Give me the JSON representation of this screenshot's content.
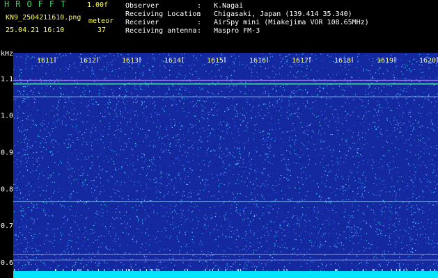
{
  "header": {
    "app_title": "HROFFT",
    "version": "1.00f",
    "file_name": "KN9_2504211610.png",
    "mode": "meteor",
    "datetime": "25.04.21 16:10",
    "count": "37",
    "info": [
      {
        "label": "Observer",
        "value": "K.Nagai"
      },
      {
        "label": "Receiving Location",
        "value": "Chigasaki, Japan (139.414 35.340)"
      },
      {
        "label": "Receiver",
        "value": "AirSpy mini (Miakejima VOR 108.65MHz)"
      },
      {
        "label": "Receiving antenna",
        "value": "Maspro FM-3"
      }
    ]
  },
  "spectrogram": {
    "y_unit": "kHz",
    "y_ticks": [
      "1.1",
      "1.0",
      "0.9",
      "0.8",
      "0.7",
      "0.6"
    ],
    "y_tick_values": [
      1.1,
      1.0,
      0.9,
      0.8,
      0.7,
      0.6
    ],
    "y_range": [
      0.575,
      1.17
    ],
    "x_ticks": [
      "1611",
      "1612",
      "1613",
      "1614",
      "1615",
      "1616",
      "1617",
      "1618",
      "1619",
      "1620"
    ],
    "carrier_lines_khz": [
      1.095,
      1.085,
      1.05,
      0.765,
      0.62,
      0.605
    ],
    "colors": {
      "background": "#1428a0",
      "tick_label": "#ffff60",
      "axis_label": "#ffffff",
      "bottom_band": "#00e5ff",
      "carrier_main": "#ff60ff",
      "carrier_secondary": "#60ffb0"
    }
  }
}
